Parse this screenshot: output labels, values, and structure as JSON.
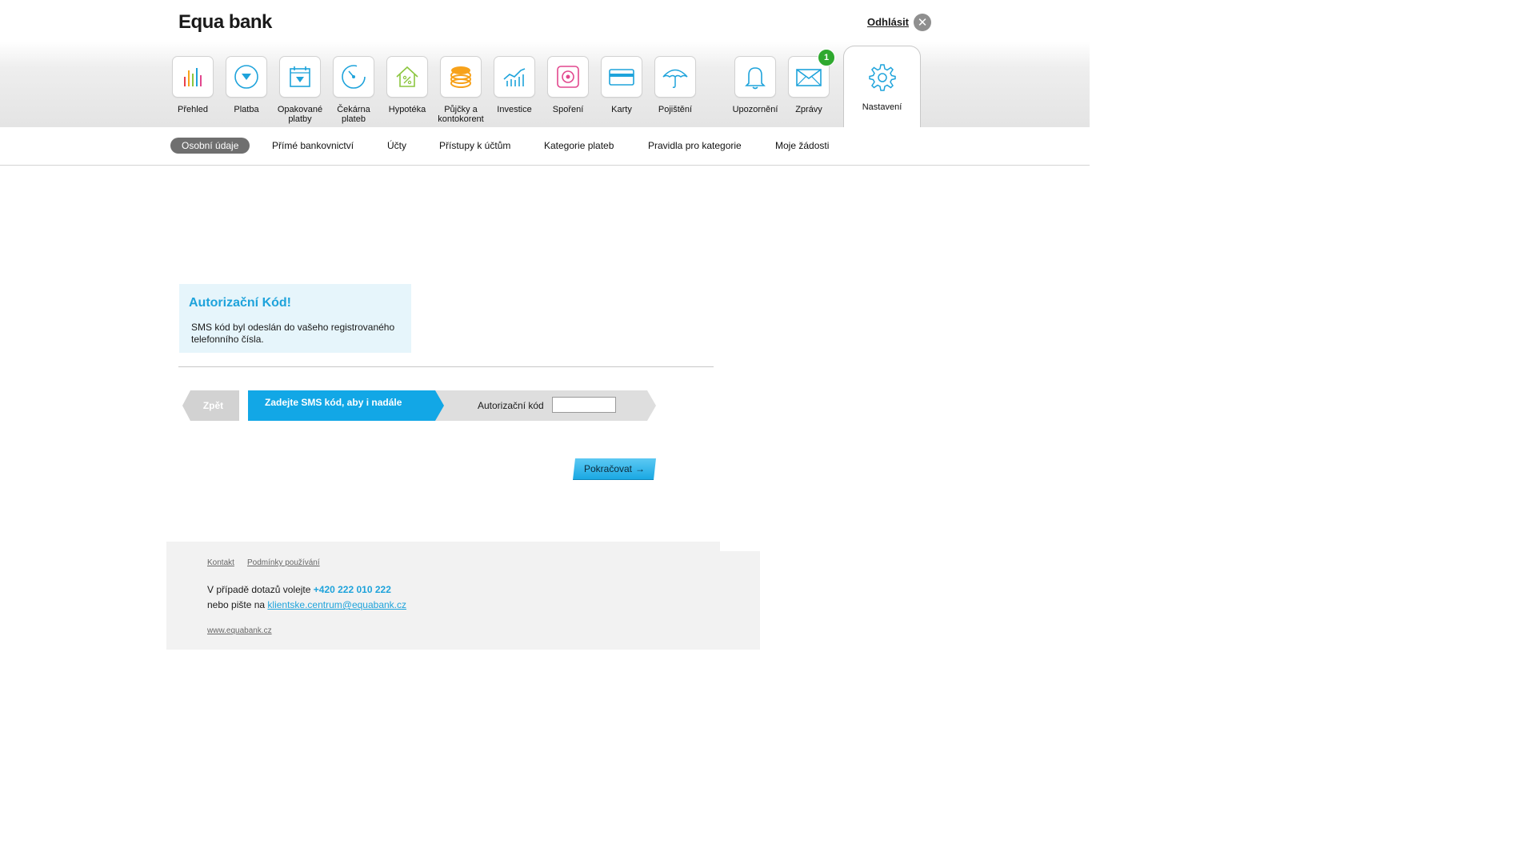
{
  "header": {
    "logo_text": "Equa bank",
    "logout_label": "Odhlásit"
  },
  "nav": {
    "items": [
      {
        "label": "Přehled",
        "icon": "chart-bars-icon"
      },
      {
        "label": "Platba",
        "icon": "payment-arrow-icon"
      },
      {
        "label": "Opakované platby",
        "icon": "calendar-icon"
      },
      {
        "label": "Čekárna plateb",
        "icon": "clock-gauge-icon"
      },
      {
        "label": "Hypotéka",
        "icon": "house-percent-icon"
      },
      {
        "label": "Půjčky a kontokorent",
        "icon": "coins-stack-icon"
      },
      {
        "label": "Investice",
        "icon": "growth-chart-icon"
      },
      {
        "label": "Spoření",
        "icon": "safe-icon"
      },
      {
        "label": "Karty",
        "icon": "card-icon"
      },
      {
        "label": "Pojištění",
        "icon": "umbrella-icon"
      },
      {
        "label": "Upozornění",
        "icon": "bell-icon"
      },
      {
        "label": "Zprávy",
        "icon": "envelope-icon"
      }
    ],
    "messages_badge": "1",
    "active_item": {
      "label": "Nastavení",
      "icon": "gear-icon"
    }
  },
  "subnav": {
    "items": [
      "Osobní údaje",
      "Přímé bankovnictví",
      "Účty",
      "Přístupy k účtům",
      "Kategorie plateb",
      "Pravidla pro kategorie",
      "Moje žádosti"
    ],
    "active": "Osobní údaje"
  },
  "auth": {
    "title": "Autorizační Kód!",
    "message": "SMS kód byl odeslán do vašeho registrovaného telefonního čísla.",
    "back_label": "Zpět",
    "step_label": "Zadejte SMS kód, aby i nadále",
    "code_label": "Autorizační kód",
    "code_value": "",
    "continue_label": "Pokračovat"
  },
  "footer": {
    "link_contact": "Kontakt",
    "link_terms": "Podmínky používání",
    "call_text": "V případě dotazů volejte",
    "phone": "+420 222 010 222",
    "write_text": "nebo pište na",
    "email": "klientske.centrum@equabank.cz",
    "website": "www.equabank.cz"
  },
  "colors": {
    "accent_blue": "#1ea3db",
    "step_blue": "#12a7e6",
    "badge_green": "#2fa92f",
    "subnav_active": "#6f6f6f"
  }
}
